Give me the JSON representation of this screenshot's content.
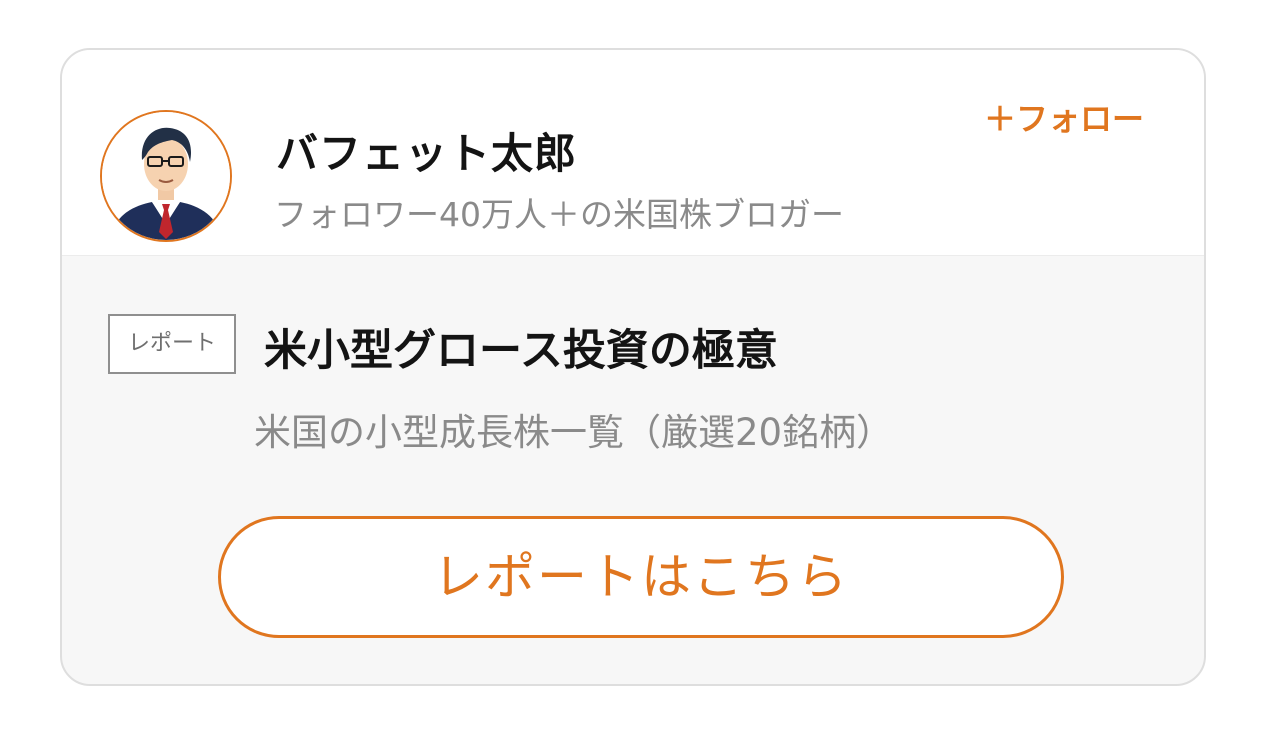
{
  "author": {
    "name": "バフェット太郎",
    "description": "フォロワー40万人＋の米国株ブロガー",
    "follow_label": "＋フォロー",
    "avatar_icon": "businessman-avatar-icon"
  },
  "report": {
    "tag": "レポート",
    "title": "米小型グロース投資の極意",
    "subtitle": "米国の小型成長株一覧（厳選20銘柄）",
    "cta_label": "レポートはこちら"
  },
  "colors": {
    "accent": "#e0761f",
    "card_background": "#f7f7f7",
    "card_border": "#dedede",
    "title_text": "#141414",
    "muted_text": "#8a8a8a"
  }
}
